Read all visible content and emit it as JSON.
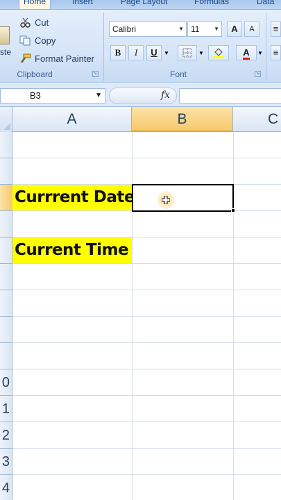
{
  "ribbon": {
    "tabs": [
      {
        "label": "Home",
        "active": true
      },
      {
        "label": "Insert",
        "active": false
      },
      {
        "label": "Page Layout",
        "active": false
      },
      {
        "label": "Formulas",
        "active": false
      },
      {
        "label": "Data",
        "active": false
      }
    ],
    "clipboard": {
      "paste_label": "ste",
      "cut_label": "Cut",
      "copy_label": "Copy",
      "format_painter_label": "Format Painter",
      "group_label": "Clipboard"
    },
    "font": {
      "font_name": "Calibri",
      "font_size": "11",
      "bold_label": "B",
      "italic_label": "I",
      "underline_label": "U",
      "grow_label": "A",
      "shrink_label": "A",
      "font_color_label": "A",
      "group_label": "Font"
    }
  },
  "formula_bar": {
    "name_box": "B3",
    "fx_label": "fx",
    "value": ""
  },
  "grid": {
    "columns": [
      {
        "label": "A",
        "selected": false
      },
      {
        "label": "B",
        "selected": true
      },
      {
        "label": "C",
        "selected": false
      }
    ],
    "rows": [
      {
        "label": "",
        "selected": false
      },
      {
        "label": "",
        "selected": false
      },
      {
        "label": "",
        "selected": true
      },
      {
        "label": "",
        "selected": false
      },
      {
        "label": "",
        "selected": false
      },
      {
        "label": "",
        "selected": false
      },
      {
        "label": "",
        "selected": false
      },
      {
        "label": "",
        "selected": false
      },
      {
        "label": "",
        "selected": false
      },
      {
        "label": "0",
        "selected": false
      },
      {
        "label": "1",
        "selected": false
      },
      {
        "label": "2",
        "selected": false
      },
      {
        "label": "3",
        "selected": false
      },
      {
        "label": "4",
        "selected": false
      }
    ],
    "cells": {
      "a3": "Currrent Date",
      "a5": "Current Time",
      "b3": ""
    },
    "highlight_color": "#ffff00",
    "selection_color": "#f7c96c"
  }
}
